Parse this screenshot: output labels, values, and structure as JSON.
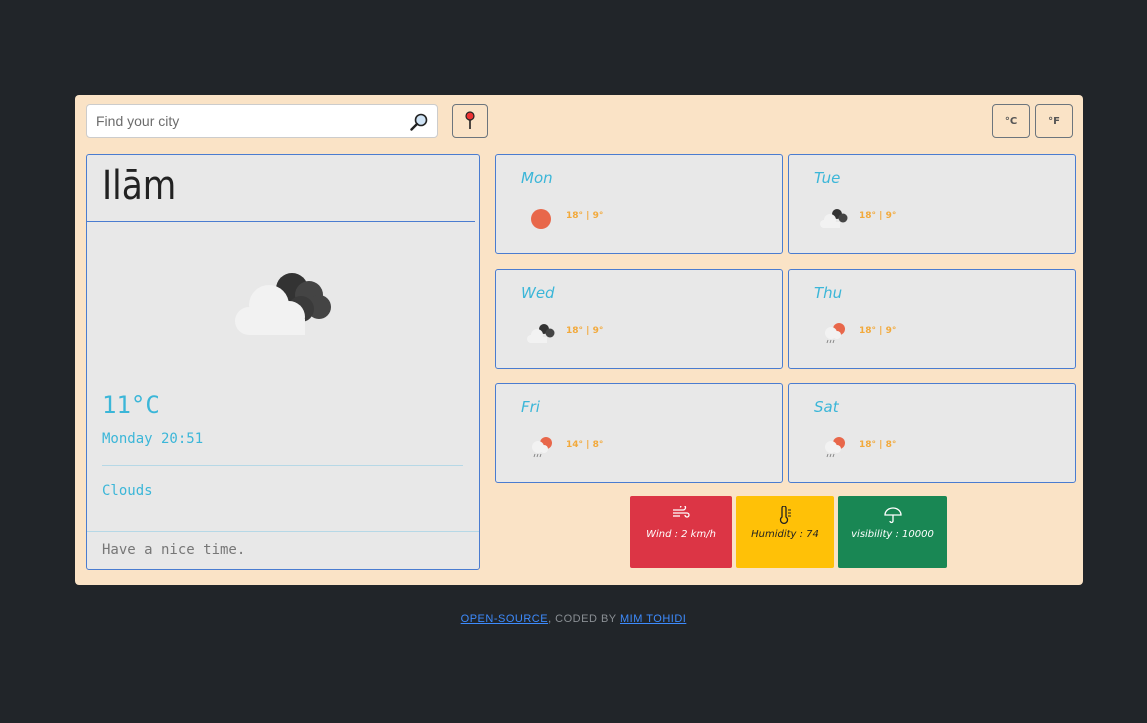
{
  "search": {
    "placeholder": "Find your city"
  },
  "icons": {
    "search": "magnifier-icon",
    "location": "pin-icon"
  },
  "units": {
    "celsius": "°C",
    "fahrenheit": "°F"
  },
  "current": {
    "city": "Ilām",
    "temperature": "11°C",
    "datetime": "Monday 20:51",
    "condition": "Clouds",
    "message": "Have a nice time."
  },
  "forecast": [
    {
      "day": "Mon",
      "temps": "18° | 9°",
      "icon": "sun-icon"
    },
    {
      "day": "Tue",
      "temps": "18° | 9°",
      "icon": "cloudy-icon"
    },
    {
      "day": "Wed",
      "temps": "18° | 9°",
      "icon": "cloudy-icon"
    },
    {
      "day": "Thu",
      "temps": "18° | 9°",
      "icon": "rain-sun-icon"
    },
    {
      "day": "Fri",
      "temps": "14° | 8°",
      "icon": "rain-sun-icon"
    },
    {
      "day": "Sat",
      "temps": "18° | 8°",
      "icon": "rain-sun-icon"
    }
  ],
  "stats": {
    "wind": "Wind : 2 km/h",
    "humidity": "Humidity : 74",
    "visibility": "visibility : 10000"
  },
  "colors": {
    "panel": "#fae3c6",
    "accent_text": "#3bb6d8",
    "card_border": "#4a7cd0",
    "wind": "#dc3545",
    "humidity": "#ffc107",
    "visibility": "#198754",
    "forecast_temp": "#f2a93b"
  },
  "footer": {
    "link1": "OPEN-SOURCE",
    "separator": ", CODED BY",
    "link2": "MIM TOHIDI"
  }
}
